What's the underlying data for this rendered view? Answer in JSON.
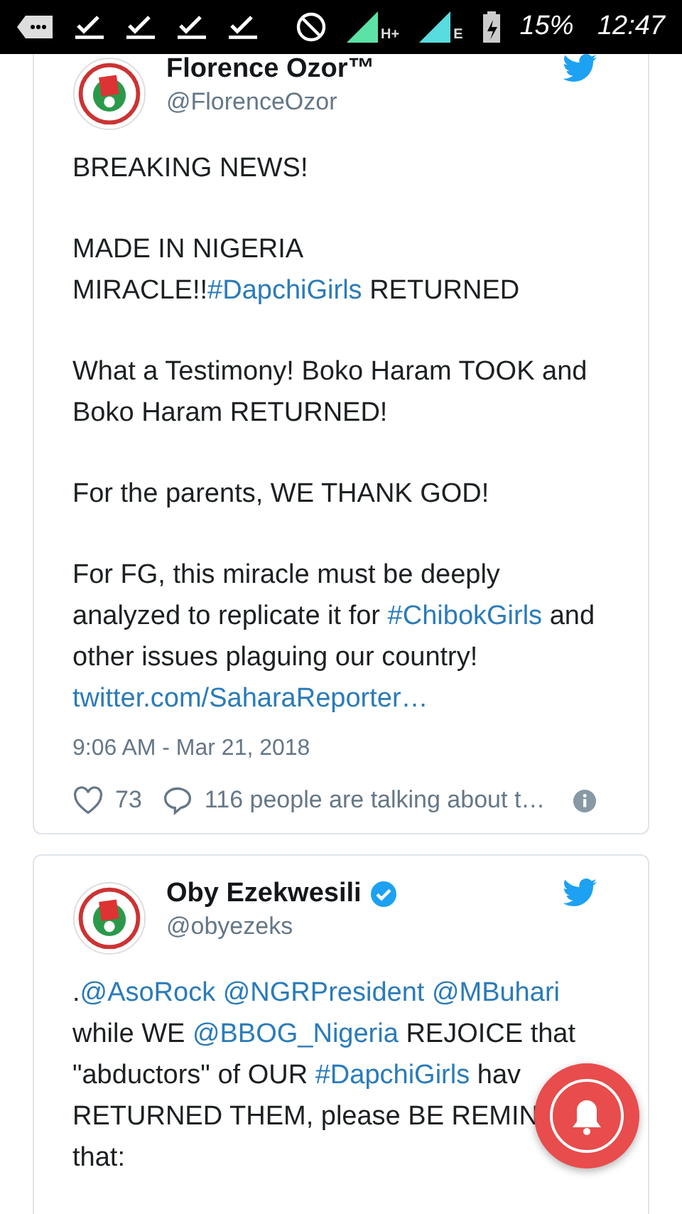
{
  "status_bar": {
    "network_labels": [
      "H+",
      "E"
    ],
    "battery": "15%",
    "time": "12:47"
  },
  "tweets": [
    {
      "name": "Florence Ozor™",
      "handle": "@FlorenceOzor",
      "verified": false,
      "paragraphs": [
        [
          {
            "kind": "text",
            "text": "BREAKING NEWS!"
          }
        ],
        [
          {
            "kind": "text",
            "text": "MADE IN NIGERIA"
          },
          {
            "kind": "break"
          },
          {
            "kind": "text",
            "text": "MIRACLE!!"
          },
          {
            "kind": "link",
            "text": "#DapchiGirls"
          },
          {
            "kind": "text",
            "text": " RETURNED"
          }
        ],
        [
          {
            "kind": "text",
            "text": "What a Testimony! Boko Haram TOOK and Boko Haram RETURNED!"
          }
        ],
        [
          {
            "kind": "text",
            "text": "For the parents, WE THANK GOD!"
          }
        ],
        [
          {
            "kind": "text",
            "text": "For FG, this miracle must be deeply analyzed to replicate it for "
          },
          {
            "kind": "link",
            "text": "#ChibokGirls"
          },
          {
            "kind": "text",
            "text": " and other issues plaguing our country! "
          },
          {
            "kind": "link",
            "text": "twitter.com/SaharaReporter…"
          }
        ]
      ],
      "timestamp": "9:06 AM - Mar 21, 2018",
      "likes": "73",
      "talking": "116 people are talking about t…"
    },
    {
      "name": "Oby Ezekwesili",
      "handle": "@obyezeks",
      "verified": true,
      "paragraphs": [
        [
          {
            "kind": "text",
            "text": "."
          },
          {
            "kind": "link",
            "text": "@AsoRock",
            "space_after": true
          },
          {
            "kind": "link",
            "text": "@NGRPresident",
            "space_after": true
          },
          {
            "kind": "link",
            "text": "@MBuhari"
          },
          {
            "kind": "text",
            "text": " while WE "
          },
          {
            "kind": "link",
            "text": "@BBOG_Nigeria"
          },
          {
            "kind": "text",
            "text": " REJOICE that \"abductors\" of OUR "
          },
          {
            "kind": "link",
            "text": "#DapchiGirls"
          },
          {
            "kind": "text",
            "text": " hav"
          },
          {
            "kind": "break"
          },
          {
            "kind": "text",
            "text": "RETURNED THEM, please BE REMIN"
          },
          {
            "kind": "break"
          },
          {
            "kind": "text",
            "text": "that:"
          }
        ]
      ]
    }
  ]
}
